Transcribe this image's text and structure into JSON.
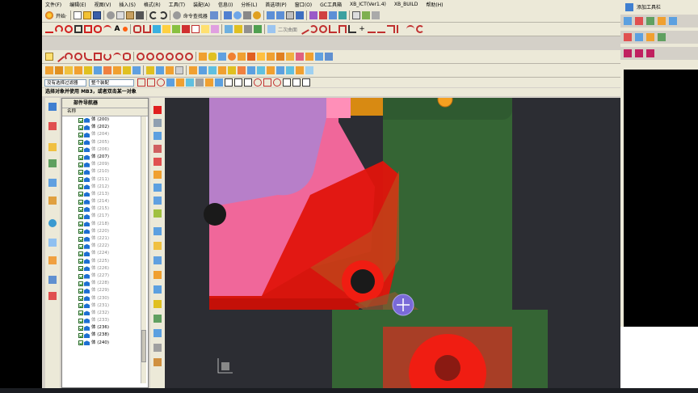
{
  "menubar": [
    "文件(F)",
    "编辑(E)",
    "视图(V)",
    "插入(S)",
    "格式(R)",
    "工具(T)",
    "装配(A)",
    "信息(I)",
    "分析(L)",
    "首选项(P)",
    "窗口(O)",
    "GC工具箱",
    "XB_ICT(Ver1.4)",
    "XB_BUILD",
    "帮助(H)"
  ],
  "toolbar1": {
    "start_label": "开始·",
    "cmd_finder": "命令查找器"
  },
  "toolbar2": {
    "label_mid": "二次曲面"
  },
  "selection": {
    "filter_label": "没有选择过滤器",
    "scope_label": "整个装配"
  },
  "prompt_text": "选择对象并使用 MB3，或者双击某一对象",
  "navigator": {
    "title": "部件导航器",
    "col_header": "名称",
    "rows": [
      {
        "label": "体 (200)",
        "gray": false
      },
      {
        "label": "体 (202)",
        "gray": false
      },
      {
        "label": "体 (204)",
        "gray": true
      },
      {
        "label": "体 (205)",
        "gray": true
      },
      {
        "label": "体 (206)",
        "gray": true
      },
      {
        "label": "体 (207)",
        "gray": false
      },
      {
        "label": "体 (209)",
        "gray": true
      },
      {
        "label": "体 (210)",
        "gray": true
      },
      {
        "label": "体 (211)",
        "gray": true
      },
      {
        "label": "体 (212)",
        "gray": true
      },
      {
        "label": "体 (213)",
        "gray": true
      },
      {
        "label": "体 (214)",
        "gray": true
      },
      {
        "label": "体 (215)",
        "gray": true
      },
      {
        "label": "体 (217)",
        "gray": true
      },
      {
        "label": "体 (218)",
        "gray": true
      },
      {
        "label": "体 (220)",
        "gray": true
      },
      {
        "label": "体 (221)",
        "gray": true
      },
      {
        "label": "体 (222)",
        "gray": true
      },
      {
        "label": "体 (224)",
        "gray": true
      },
      {
        "label": "体 (225)",
        "gray": true
      },
      {
        "label": "体 (226)",
        "gray": true
      },
      {
        "label": "体 (227)",
        "gray": true
      },
      {
        "label": "体 (228)",
        "gray": true
      },
      {
        "label": "体 (229)",
        "gray": true
      },
      {
        "label": "体 (230)",
        "gray": true
      },
      {
        "label": "体 (231)",
        "gray": true
      },
      {
        "label": "体 (232)",
        "gray": true
      },
      {
        "label": "体 (233)",
        "gray": true
      },
      {
        "label": "体 (236)",
        "gray": false
      },
      {
        "label": "体 (238)",
        "gray": false
      },
      {
        "label": "体 (240)",
        "gray": false
      }
    ]
  },
  "rightbar": {
    "title": "添加工具栏"
  },
  "colors": {
    "pink": "#f0679a",
    "red": "#e0140c",
    "green": "#356534",
    "orange": "#ff8c1a",
    "purple": "#b77fc9",
    "dark": "#2c2d33",
    "brown": "#a83e26"
  }
}
